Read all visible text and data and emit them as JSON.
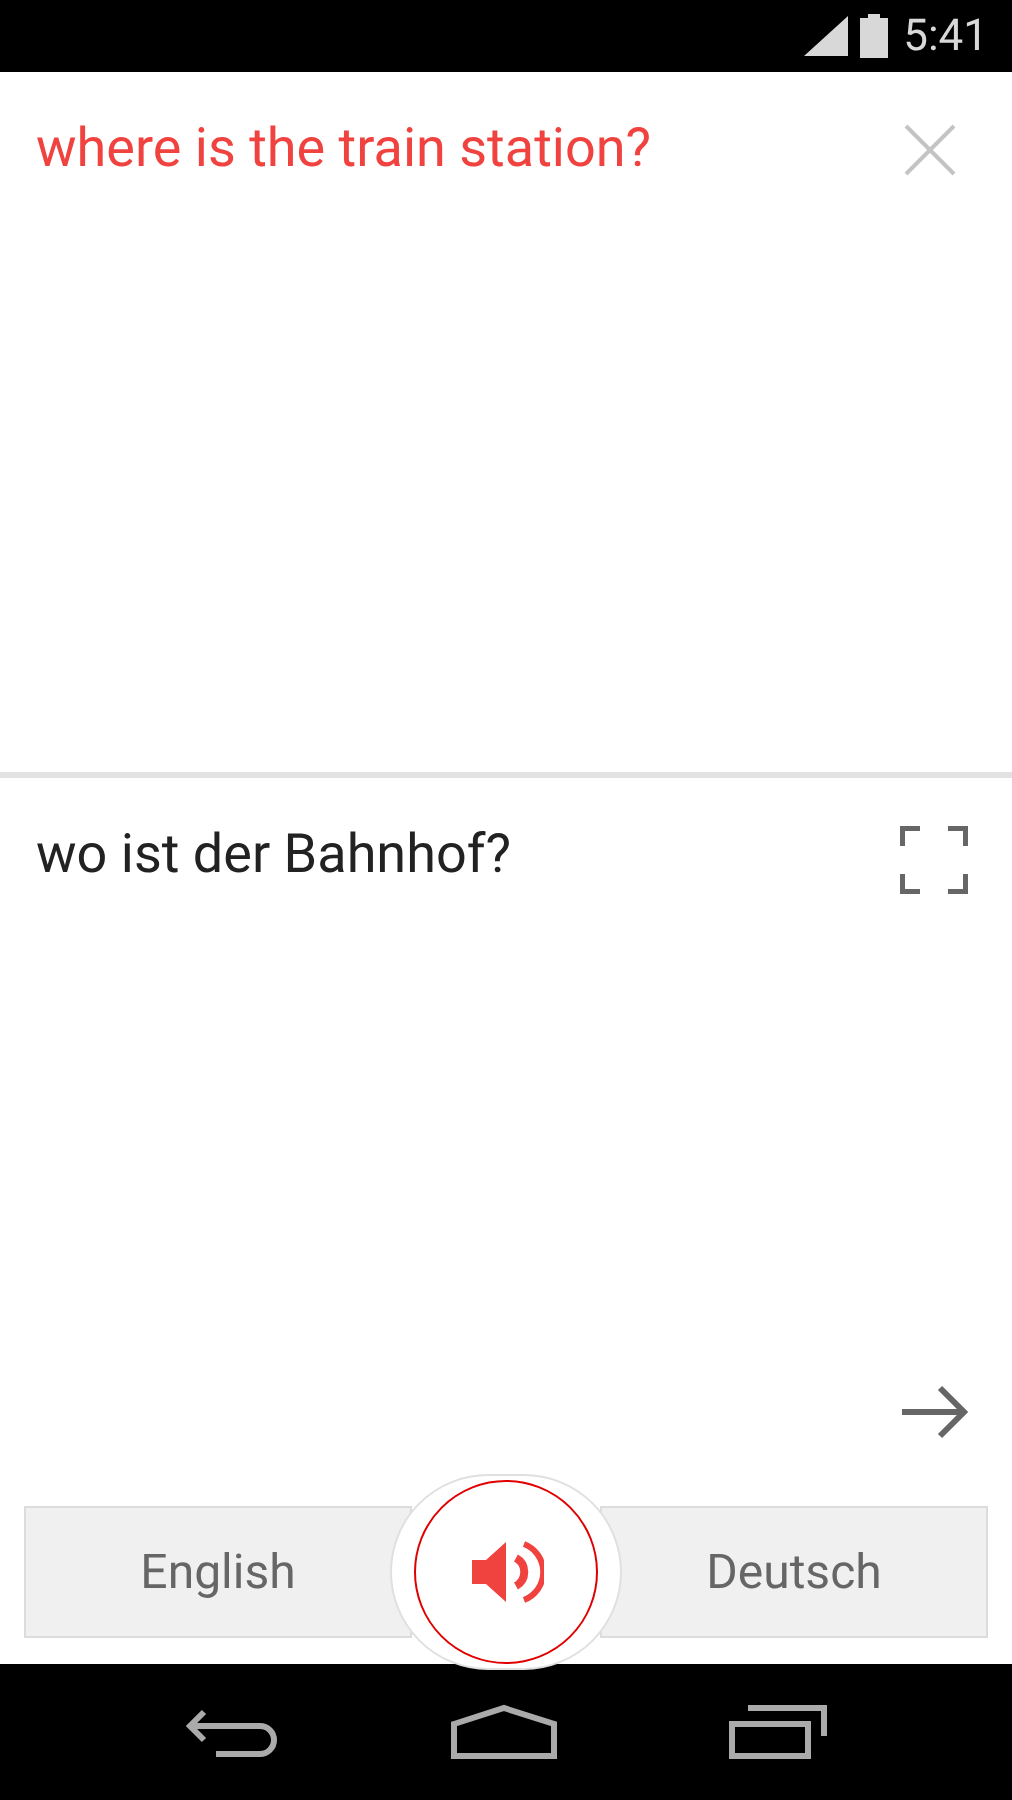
{
  "status_bar": {
    "time": "5:41"
  },
  "source": {
    "text": "where is the train station?"
  },
  "translation": {
    "text": "wo ist der Bahnhof?"
  },
  "languages": [
    {
      "label": "English"
    },
    {
      "label": "Deutsch"
    }
  ]
}
